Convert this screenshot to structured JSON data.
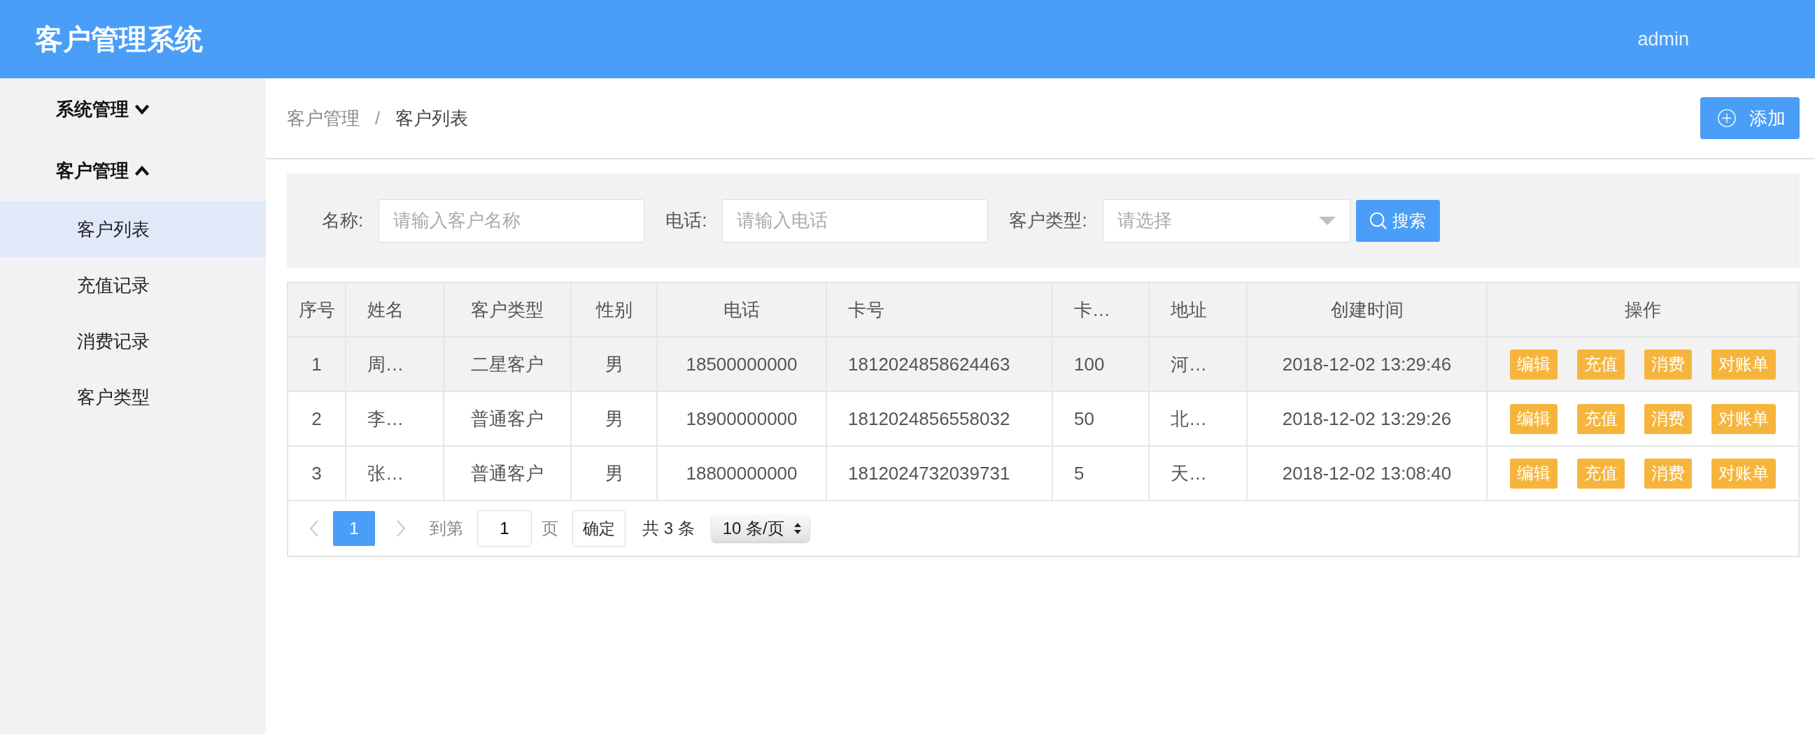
{
  "header": {
    "title": "客户管理系统",
    "user": "admin"
  },
  "sidebar": {
    "groups": [
      {
        "label": "系统管理",
        "expanded": false
      },
      {
        "label": "客户管理",
        "expanded": true,
        "children": [
          {
            "label": "客户列表",
            "selected": true
          },
          {
            "label": "充值记录",
            "selected": false
          },
          {
            "label": "消费记录",
            "selected": false
          },
          {
            "label": "客户类型",
            "selected": false
          }
        ]
      }
    ]
  },
  "breadcrumb": [
    "客户管理",
    "客户列表"
  ],
  "breadcrumb_separator": "/",
  "add_button": "添加",
  "search": {
    "fields": [
      {
        "kind": "input",
        "label": "名称:",
        "placeholder": "请输入客户名称"
      },
      {
        "kind": "input",
        "label": "电话:",
        "placeholder": "请输入电话"
      },
      {
        "kind": "select",
        "label": "客户类型:",
        "placeholder": "请选择"
      }
    ],
    "button": "搜索"
  },
  "table": {
    "columns": [
      "序号",
      "姓名",
      "客户类型",
      "性别",
      "电话",
      "卡号",
      "卡…",
      "地址",
      "创建时间",
      "操作"
    ],
    "rows": [
      {
        "selected": true,
        "cells": [
          "1",
          "周…",
          "二星客户",
          "男",
          "18500000000",
          "1812024858624463",
          "100",
          "河…",
          "2018-12-02 13:29:46"
        ],
        "actions": [
          "编辑",
          "充值",
          "消费",
          "对账单"
        ]
      },
      {
        "selected": false,
        "cells": [
          "2",
          "李…",
          "普通客户",
          "男",
          "18900000000",
          "1812024856558032",
          "50",
          "北…",
          "2018-12-02 13:29:26"
        ],
        "actions": [
          "编辑",
          "充值",
          "消费",
          "对账单"
        ]
      },
      {
        "selected": false,
        "cells": [
          "3",
          "张…",
          "普通客户",
          "男",
          "18800000000",
          "1812024732039731",
          "5",
          "天…",
          "2018-12-02 13:08:40"
        ],
        "actions": [
          "编辑",
          "充值",
          "消费",
          "对账单"
        ]
      }
    ]
  },
  "pagination": {
    "prev_disabled": true,
    "next_disabled": true,
    "pages": [
      {
        "label": "1",
        "selected": true
      }
    ],
    "goto_label": "到第",
    "goto_value": "1",
    "page_unit": "页",
    "confirm": "确定",
    "total": "共 3 条",
    "page_size": "10 条/页"
  }
}
